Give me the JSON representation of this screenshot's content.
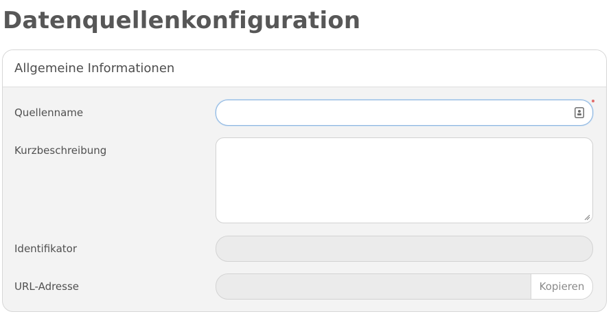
{
  "page": {
    "title": "Datenquellenkonfiguration"
  },
  "panel": {
    "title": "Allgemeine Informationen",
    "fields": {
      "source_name": {
        "label": "Quellenname",
        "value": "",
        "icon": "contact-card-icon",
        "required": true
      },
      "description": {
        "label": "Kurzbeschreibung",
        "value": ""
      },
      "identifier": {
        "label": "Identifikator",
        "value": ""
      },
      "url": {
        "label": "URL-Adresse",
        "value": "",
        "copy_label": "Kopieren"
      }
    }
  },
  "colors": {
    "focus_border": "#8fb6df",
    "required_marker": "#e06a6a",
    "panel_bg": "#f3f3f3",
    "disabled_bg": "#ebebeb"
  }
}
